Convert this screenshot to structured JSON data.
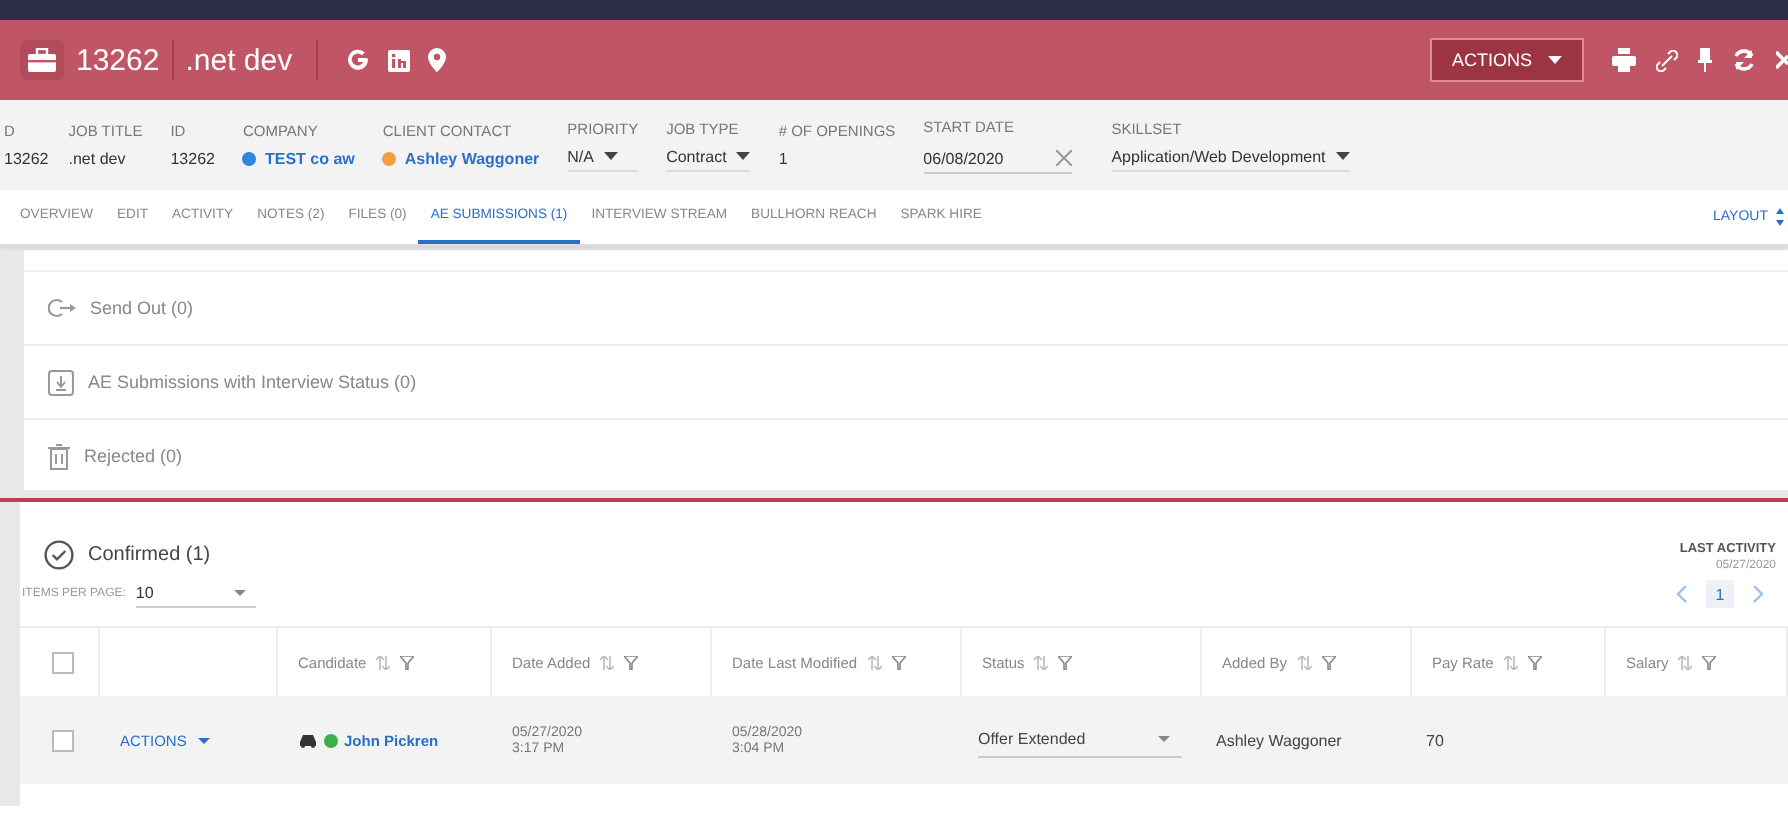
{
  "header": {
    "job_id": "13262",
    "job_title": ".net dev",
    "actions_label": "ACTIONS"
  },
  "info_fields": [
    {
      "kind": "text",
      "label": "D",
      "value": "13262"
    },
    {
      "kind": "text",
      "label": "JOB TITLE",
      "value": ".net dev"
    },
    {
      "kind": "text",
      "label": "ID",
      "value": "13262"
    },
    {
      "kind": "link",
      "label": "COMPANY",
      "value": "TEST co aw",
      "color": "#2e86de"
    },
    {
      "kind": "link",
      "label": "CLIENT CONTACT",
      "value": "Ashley Waggoner",
      "color": "#f0a040"
    },
    {
      "kind": "select",
      "label": "PRIORITY",
      "value": "N/A"
    },
    {
      "kind": "select",
      "label": "JOB TYPE",
      "value": "Contract"
    },
    {
      "kind": "text",
      "label": "# OF OPENINGS",
      "value": "1"
    },
    {
      "kind": "date",
      "label": "START DATE",
      "value": "06/08/2020"
    },
    {
      "kind": "select",
      "label": "SKILLSET",
      "value": "Application/Web Development"
    }
  ],
  "tabs": [
    {
      "label": "OVERVIEW",
      "selected": false
    },
    {
      "label": "EDIT",
      "selected": false
    },
    {
      "label": "ACTIVITY",
      "selected": false
    },
    {
      "label": "NOTES (2)",
      "selected": false
    },
    {
      "label": "FILES (0)",
      "selected": false
    },
    {
      "label": "AE SUBMISSIONS (1)",
      "selected": true
    },
    {
      "label": "INTERVIEW STREAM",
      "selected": false
    },
    {
      "label": "BULLHORN REACH",
      "selected": false
    },
    {
      "label": "SPARK HIRE",
      "selected": false
    }
  ],
  "layout_label": "LAYOUT",
  "sections": [
    {
      "kind": "sendout",
      "label": "Send Out (0)"
    },
    {
      "kind": "interview",
      "label": "AE Submissions with Interview Status (0)"
    },
    {
      "kind": "rejected",
      "label": "Rejected (0)"
    }
  ],
  "confirmed": {
    "title": "Confirmed (1)",
    "last_activity_label": "LAST ACTIVITY",
    "last_activity_date": "05/27/2020",
    "items_per_page_label": "ITEMS PER PAGE:",
    "items_per_page": "10",
    "page": "1",
    "columns": [
      "Candidate",
      "Date Added",
      "Date Last Modified",
      "Status",
      "Added By",
      "Pay Rate",
      "Salary"
    ],
    "all_checked": false,
    "rows": [
      {
        "checked": false,
        "actions": "ACTIONS",
        "candidate": "John Pickren",
        "color": "#3cb04a",
        "date_added": "05/27/2020",
        "date_added_time": "3:17 PM",
        "date_modified": "05/28/2020",
        "date_modified_time": "3:04 PM",
        "status": "Offer Extended",
        "added_by": "Ashley Waggoner",
        "pay_rate": "70"
      }
    ]
  }
}
